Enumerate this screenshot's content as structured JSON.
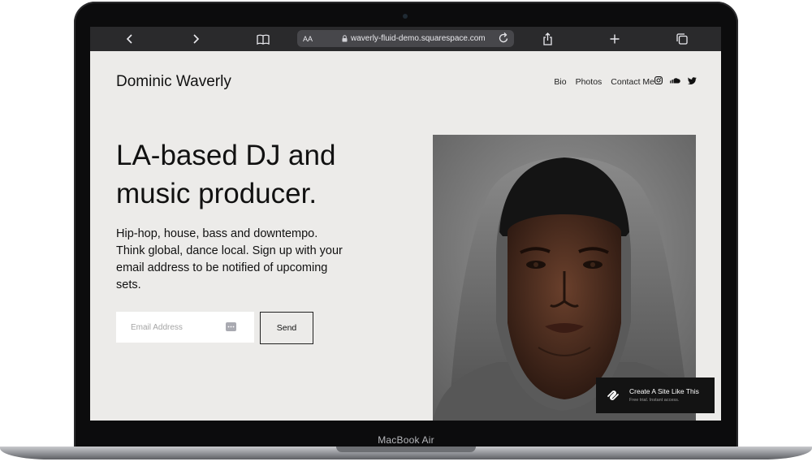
{
  "device": {
    "label": "MacBook Air"
  },
  "browser": {
    "text_size_label": "AA",
    "url": "waverly-fluid-demo.squarespace.com",
    "icons": [
      "back-icon",
      "forward-icon",
      "bookmarks-icon",
      "lock-icon",
      "reload-icon",
      "share-icon",
      "new-tab-icon",
      "tabs-icon"
    ]
  },
  "site": {
    "title": "Dominic Waverly",
    "nav": [
      "Bio",
      "Photos",
      "Contact Me"
    ],
    "social_icons": [
      "instagram-icon",
      "soundcloud-icon",
      "twitter-icon"
    ],
    "hero_line1": "LA-based DJ and",
    "hero_line2": "music producer.",
    "description": "Hip-hop, house, bass and downtempo. Think global, dance local. Sign up with your email address to be notified of upcoming sets.",
    "email_placeholder": "Email Address",
    "send_label": "Send"
  },
  "promo": {
    "title": "Create A Site Like This",
    "subtitle": "Free trial. Instant access."
  },
  "colors": {
    "page_background": "#ecebe9",
    "text": "#111111",
    "browser_bar": "#2a2a2c",
    "badge_background": "#131313"
  }
}
